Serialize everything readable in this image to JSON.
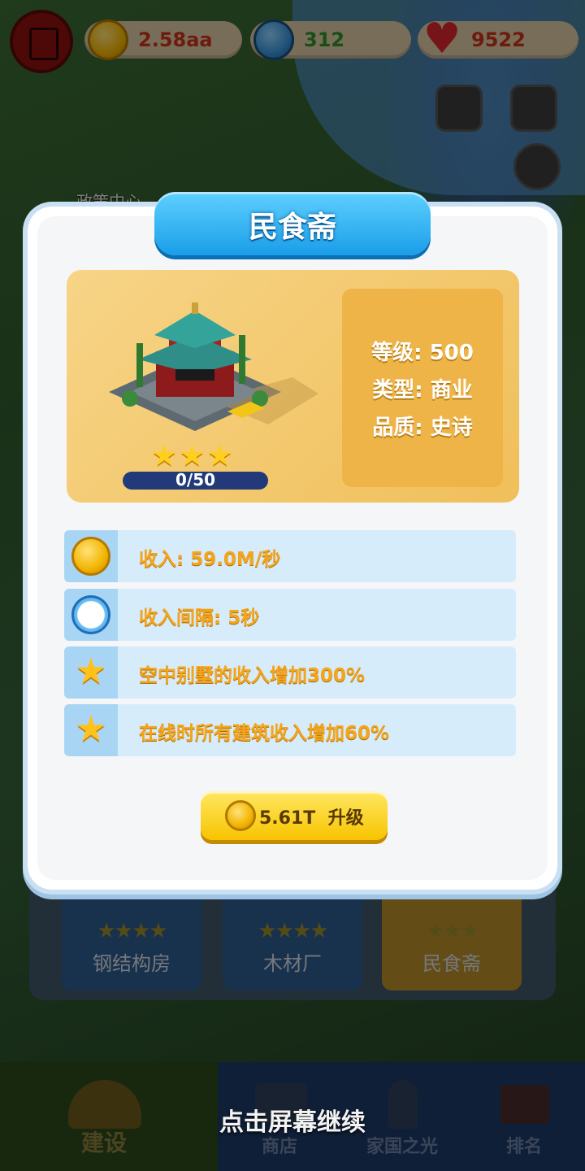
{
  "topbar": {
    "coins": "2.58aa",
    "gems": "312",
    "hearts": "9522",
    "coin_icon": "coin-icon",
    "gem_icon": "star-gem-icon",
    "heart_icon": "heart-icon"
  },
  "background": {
    "building_label": "政策中心"
  },
  "modal": {
    "title": "民食斋",
    "stats": {
      "level": "等级: 500",
      "type": "类型: 商业",
      "quality": "品质: 史诗"
    },
    "stars": "★★★",
    "star_count": 3,
    "progress_text": "0/50",
    "progress_value": 0,
    "info_rows": [
      {
        "icon": "coin-icon",
        "text": "收入: 59.0M/秒"
      },
      {
        "icon": "clock-icon",
        "text": "收入间隔: 5秒"
      },
      {
        "icon": "star-icon",
        "text": "空中别墅的收入增加300%"
      },
      {
        "icon": "star-icon",
        "text": "在线时所有建筑收入增加60%"
      }
    ],
    "upgrade_button": "5.61T  升级"
  },
  "shelf": {
    "cards": [
      {
        "label": "钢结构房",
        "stars": "★★★★"
      },
      {
        "label": "木材厂",
        "stars": "★★★★"
      },
      {
        "label": "民食斋",
        "stars": "★★★"
      }
    ]
  },
  "hint": "点击屏幕继续",
  "bottom_nav": {
    "tabs": [
      "建设",
      "商店",
      "家国之光",
      "排名"
    ]
  },
  "colors": {
    "title_blue": "#1a9ee8",
    "row_bg": "#d6ecfb",
    "row_text": "#f5a51c",
    "hero_gold": "#f0bf5a",
    "button_yellow": "#f7c400"
  }
}
